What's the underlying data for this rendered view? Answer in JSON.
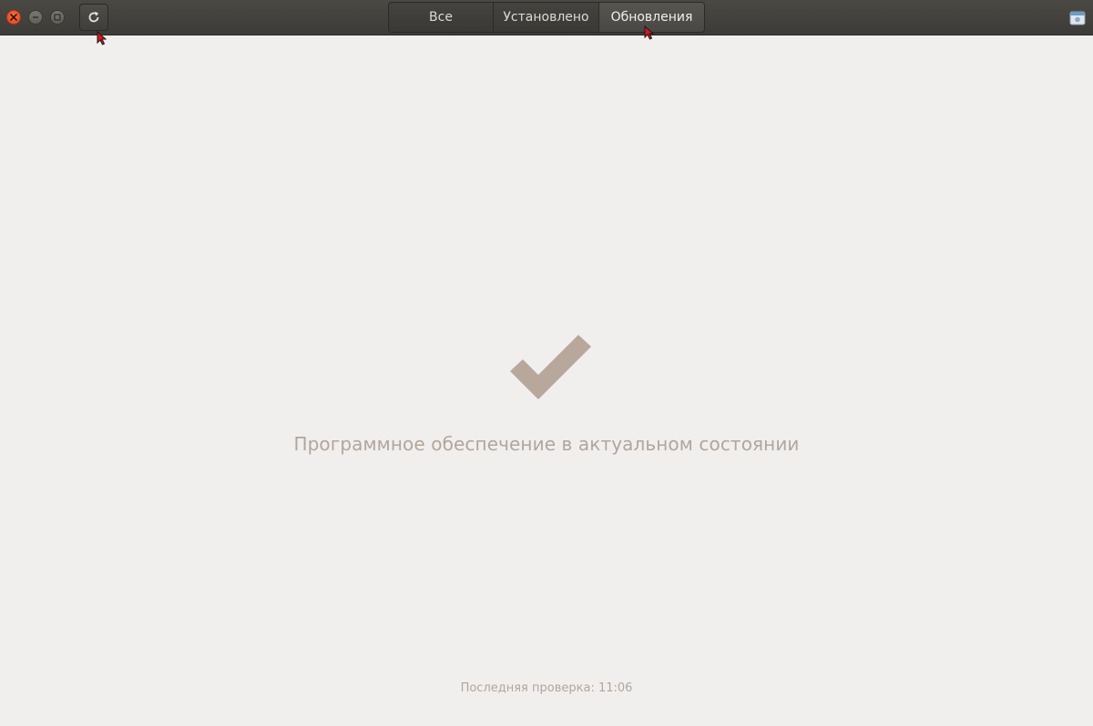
{
  "window": {
    "controls": {
      "close_icon": "close-icon",
      "minimize_icon": "minimize-icon",
      "maximize_icon": "maximize-icon"
    },
    "toolbar": {
      "refresh_icon": "refresh-icon"
    },
    "tabs": [
      {
        "label": "Все",
        "active": false
      },
      {
        "label": "Установлено",
        "active": false
      },
      {
        "label": "Обновления",
        "active": true
      }
    ],
    "app_icon": "software-center-icon"
  },
  "main": {
    "status_icon": "checkmark-icon",
    "status_text": "Программное обеспечение в актуальном состоянии",
    "last_check_label": "Последняя проверка:",
    "last_check_time": "11:06"
  },
  "colors": {
    "accent_close": "#e0421b",
    "status_text": "#b3a59c",
    "check_icon": "#b8a89c",
    "header_bg": "#3c3b37",
    "content_bg": "#f1efed"
  }
}
